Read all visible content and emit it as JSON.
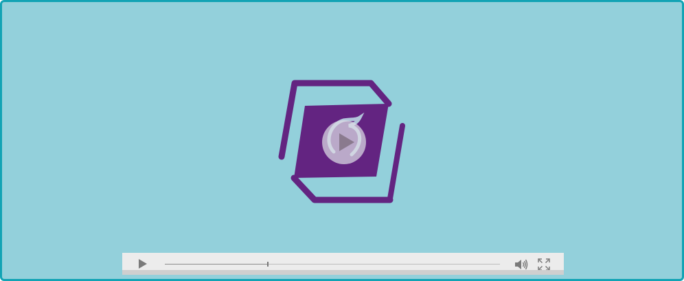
{
  "player": {
    "background_color": "#93d0db",
    "border_color": "#12a3b4",
    "poster": {
      "icon": "book-cube-logo-icon",
      "primary_color": "#632481"
    },
    "big_play_icon": "play-icon",
    "controls": {
      "play_icon": "play-icon",
      "volume_icon": "volume-icon",
      "fullscreen_icon": "fullscreen-icon",
      "progress_fraction": 0.307
    }
  }
}
